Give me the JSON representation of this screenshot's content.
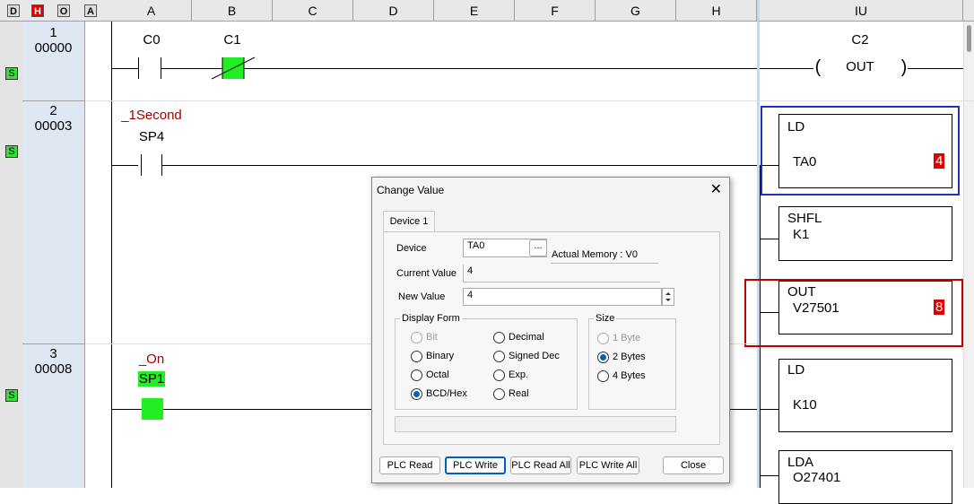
{
  "toolbar": {
    "view_buttons": [
      "D",
      "H",
      "O",
      "A"
    ]
  },
  "columns": [
    "A",
    "B",
    "C",
    "D",
    "E",
    "F",
    "G",
    "H"
  ],
  "output_column": "IU",
  "rungs": [
    {
      "number": "1",
      "address": "00000",
      "status": "S"
    },
    {
      "number": "2",
      "address": "00003",
      "status": "S"
    },
    {
      "number": "3",
      "address": "00008",
      "status": "S"
    }
  ],
  "rung1": {
    "contact_a": "C0",
    "contact_b": "C1",
    "coil": "C2",
    "coil_label": "OUT",
    "coil_left": "(",
    "coil_right": ")"
  },
  "rung2": {
    "contact_nick": "_1Second",
    "contact": "SP4",
    "boxes": [
      {
        "op": "LD",
        "arg": "TA0",
        "value": "4"
      },
      {
        "op": "SHFL",
        "arg": "K1"
      },
      {
        "op": "OUT",
        "arg": "V27501",
        "value": "8"
      }
    ]
  },
  "rung3": {
    "contact_nick": "_On",
    "contact": "SP1",
    "boxes": [
      {
        "op": "LD",
        "arg": "K10"
      },
      {
        "op": "LDA",
        "arg": "O27401"
      }
    ]
  },
  "dialog": {
    "title": "Change Value",
    "close_icon": "✕",
    "tab": "Device 1",
    "device_label": "Device",
    "device_value": "TA0",
    "browse_label": "...",
    "actual_memory": "Actual Memory : V0",
    "current_label": "Current Value",
    "current_value": "4",
    "new_label": "New Value",
    "new_value": "4",
    "display_form_label": "Display Form",
    "display_options": [
      {
        "label": "Bit",
        "state": "disabled"
      },
      {
        "label": "Decimal",
        "state": "off"
      },
      {
        "label": "Binary",
        "state": "off"
      },
      {
        "label": "Signed Dec",
        "state": "off"
      },
      {
        "label": "Octal",
        "state": "off"
      },
      {
        "label": "Exp.",
        "state": "off"
      },
      {
        "label": "BCD/Hex",
        "state": "on"
      },
      {
        "label": "Real",
        "state": "off"
      }
    ],
    "size_label": "Size",
    "size_options": [
      {
        "label": "1 Byte",
        "state": "disabled"
      },
      {
        "label": "2 Bytes",
        "state": "on"
      },
      {
        "label": "4 Bytes",
        "state": "off"
      }
    ],
    "buttons": {
      "plc_read": "PLC Read",
      "plc_write": "PLC Write",
      "plc_read_all": "PLC Read All",
      "plc_write_all": "PLC Write All",
      "close": "Close"
    }
  },
  "colors": {
    "contact_on": "#22ee22",
    "nickname": "#a00000",
    "value_badge": "#e00000",
    "select_blue": "#2030c0",
    "select_red": "#c00000"
  }
}
